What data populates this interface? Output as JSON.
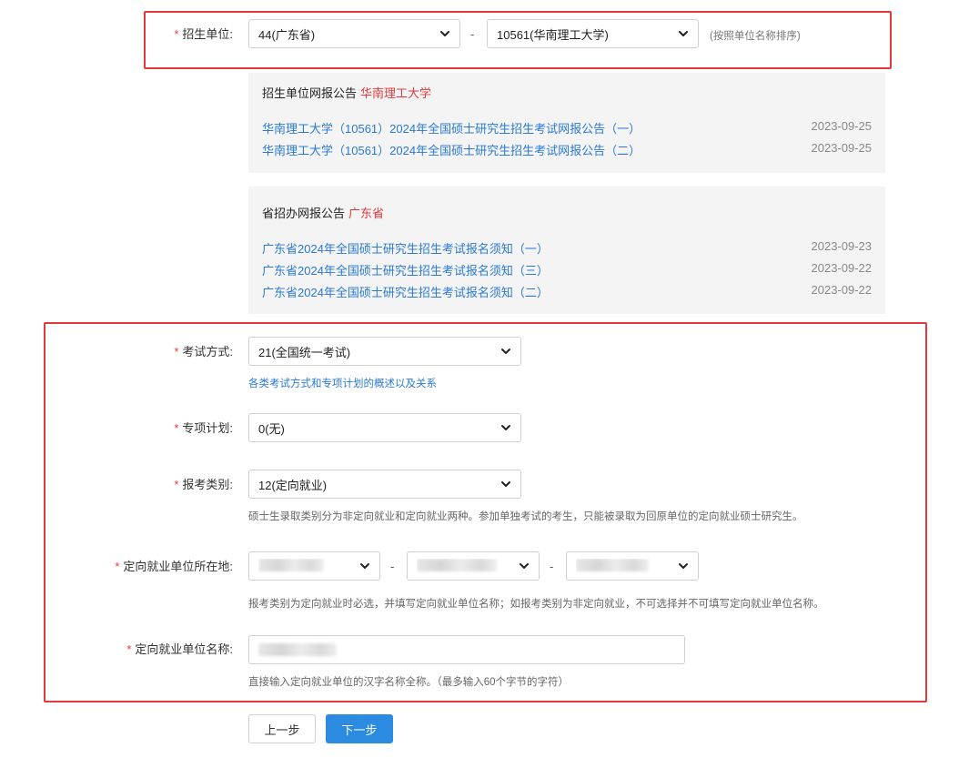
{
  "unit": {
    "label": "招生单位:",
    "province_value": "44(广东省)",
    "school_value": "10561(华南理工大学)",
    "sort_hint": "(按照单位名称排序)",
    "separator": "-"
  },
  "school_notices": {
    "title": "招生单位网报公告",
    "highlight": "华南理工大学",
    "items": [
      {
        "text": "华南理工大学（10561）2024年全国硕士研究生招生考试网报公告（一）",
        "date": "2023-09-25"
      },
      {
        "text": "华南理工大学（10561）2024年全国硕士研究生招生考试网报公告（二）",
        "date": "2023-09-25"
      }
    ]
  },
  "province_notices": {
    "title": "省招办网报公告",
    "highlight": "广东省",
    "items": [
      {
        "text": "广东省2024年全国硕士研究生招生考试报名须知（一）",
        "date": "2023-09-23"
      },
      {
        "text": "广东省2024年全国硕士研究生招生考试报名须知（三）",
        "date": "2023-09-22"
      },
      {
        "text": "广东省2024年全国硕士研究生招生考试报名须知（二）",
        "date": "2023-09-22"
      }
    ]
  },
  "exam_method": {
    "label": "考试方式:",
    "value": "21(全国统一考试)",
    "link": "各类考试方式和专项计划的概述以及关系"
  },
  "special_plan": {
    "label": "专项计划:",
    "value": "0(无)"
  },
  "apply_type": {
    "label": "报考类别:",
    "value": "12(定向就业)",
    "hint": "硕士生录取类别分为非定向就业和定向就业两种。参加单独考试的考生，只能被录取为回原单位的定向就业硕士研究生。"
  },
  "employer_location": {
    "label": "定向就业单位所在地:",
    "hint": "报考类别为定向就业时必选，并填写定向就业单位名称；如报考类别为非定向就业，不可选择并不可填写定向就业单位名称。",
    "separator": "-"
  },
  "employer_name": {
    "label": "定向就业单位名称:",
    "hint": "直接输入定向就业单位的汉字名称全称。（最多输入60个字节的字符）"
  },
  "buttons": {
    "prev": "上一步",
    "next": "下一步"
  },
  "colors": {
    "required": "#e4393c",
    "link": "#2a7ad2",
    "primary_button": "#2a8be0",
    "highlight_box": "#e4393c"
  },
  "icons": {
    "select_arrow": "chevron-down-icon"
  }
}
